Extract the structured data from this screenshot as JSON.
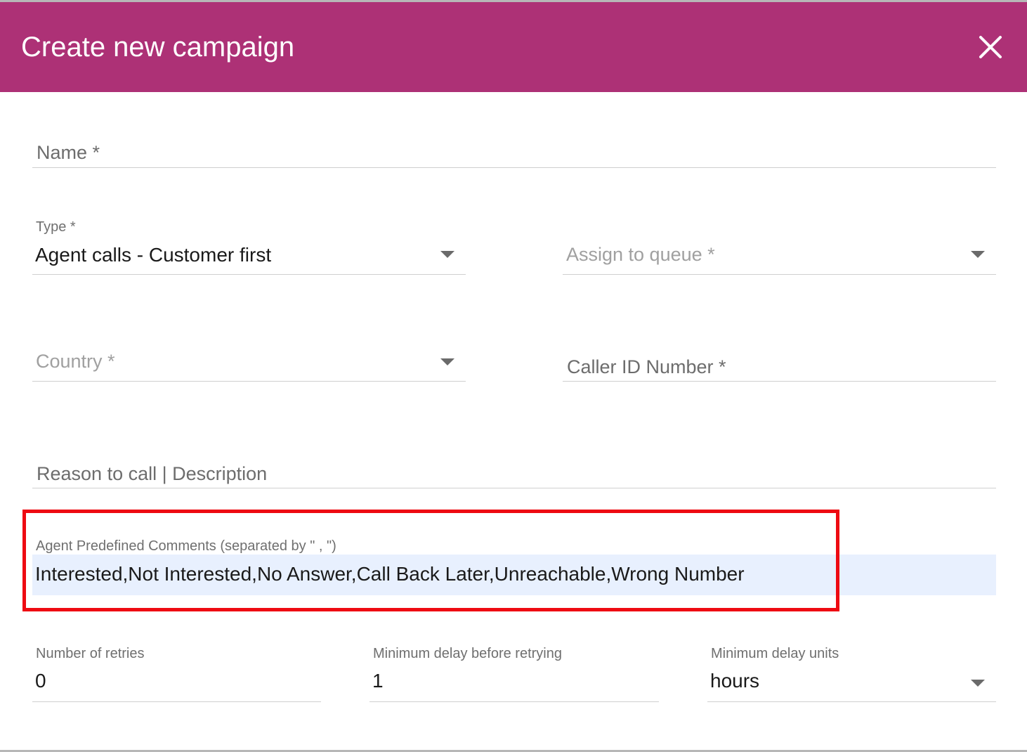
{
  "dialog": {
    "title": "Create new campaign",
    "close_icon": "close-icon",
    "header_color": "#ad3176"
  },
  "fields": {
    "name": {
      "placeholder": "Name *"
    },
    "type": {
      "label": "Type *",
      "value": "Agent calls - Customer first"
    },
    "queue": {
      "placeholder": "Assign to queue *"
    },
    "country": {
      "placeholder": "Country *"
    },
    "caller_id": {
      "placeholder": "Caller ID Number *"
    },
    "reason": {
      "placeholder": "Reason to call | Description"
    },
    "comments": {
      "label": "Agent Predefined Comments (separated by \" , \")",
      "value": "Interested,Not Interested,No Answer,Call Back Later,Unreachable,Wrong Number"
    },
    "retries": {
      "label": "Number of retries",
      "value": "0"
    },
    "min_delay": {
      "label": "Minimum delay before retrying",
      "value": "1"
    },
    "delay_units": {
      "label": "Minimum delay units",
      "value": "hours"
    }
  },
  "highlight_color": "#ee0a12"
}
